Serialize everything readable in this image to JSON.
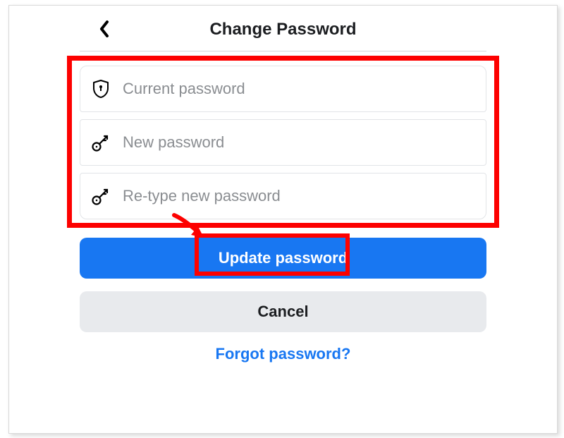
{
  "header": {
    "title": "Change Password"
  },
  "fields": {
    "current": {
      "placeholder": "Current password"
    },
    "new": {
      "placeholder": "New password"
    },
    "retype": {
      "placeholder": "Re-type new password"
    }
  },
  "buttons": {
    "update": "Update password",
    "cancel": "Cancel"
  },
  "links": {
    "forgot": "Forgot password?"
  },
  "colors": {
    "primary": "#1877f2",
    "highlight": "#fd0100"
  }
}
